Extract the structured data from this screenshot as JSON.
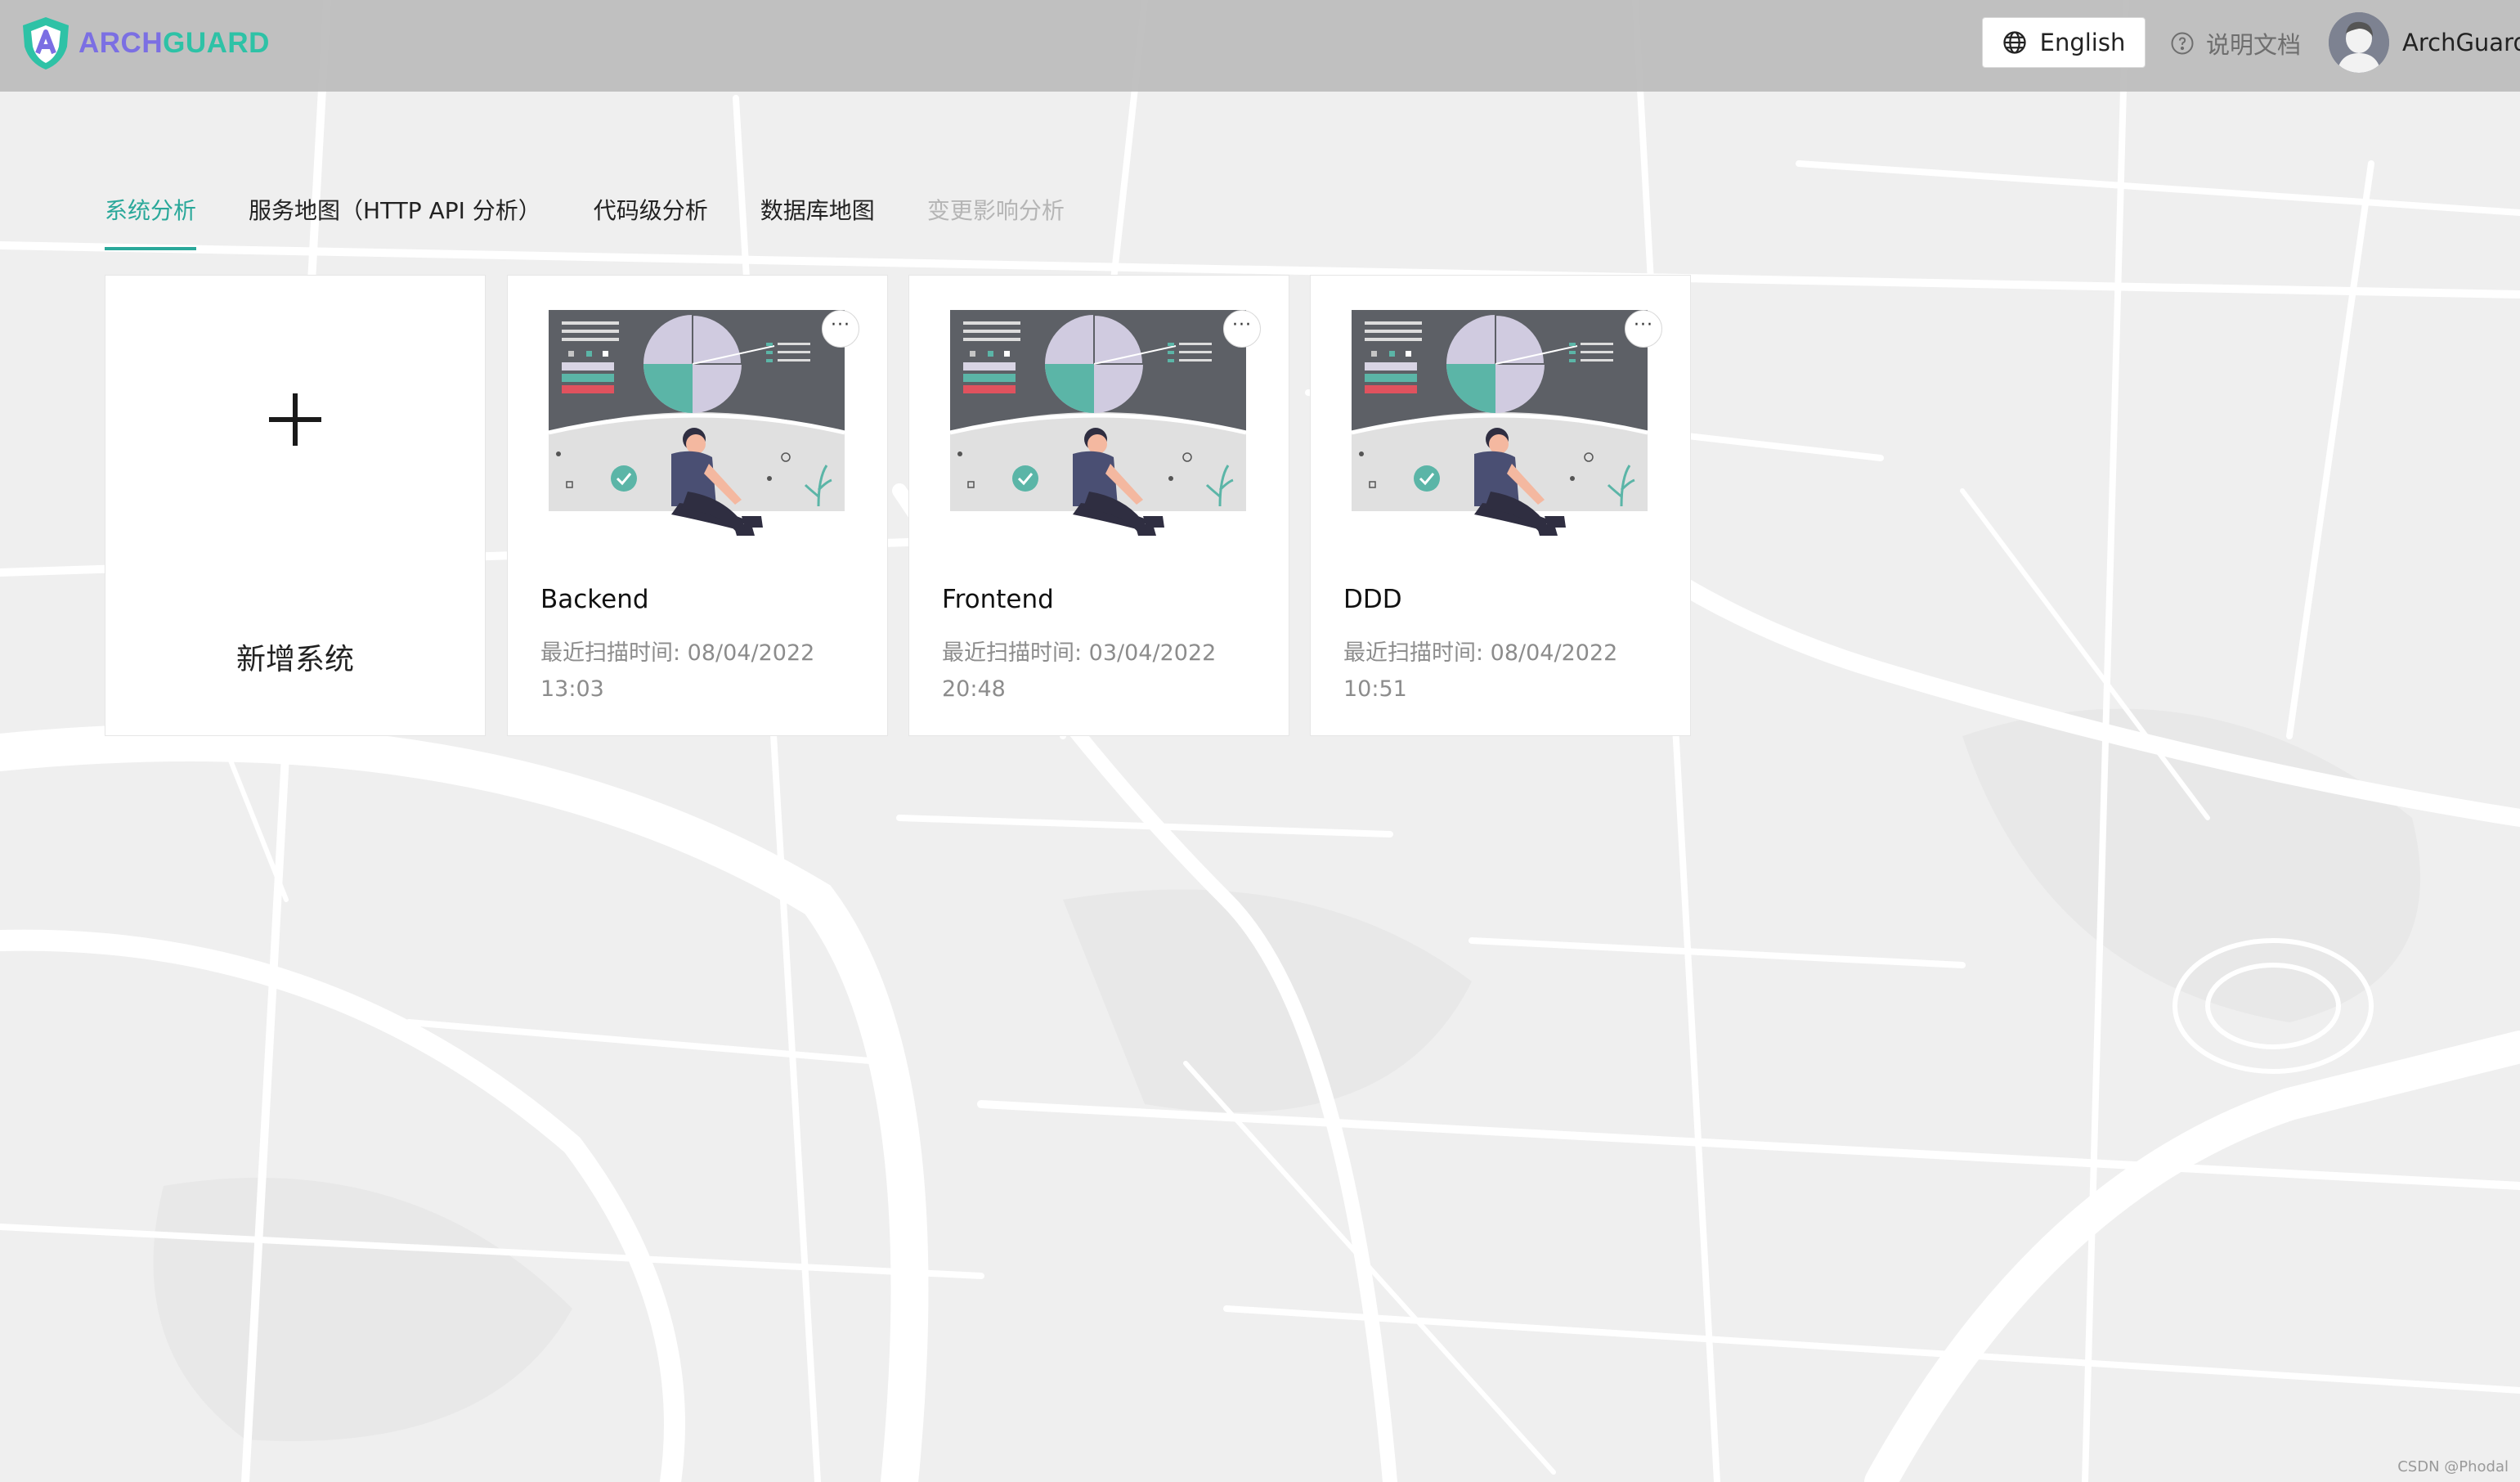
{
  "brand": {
    "part1": "ARCH",
    "part2": "GUARD"
  },
  "header": {
    "language_label": "English",
    "docs_label": "说明文档",
    "user_name": "ArchGuard"
  },
  "tabs": [
    {
      "label": "系统分析"
    },
    {
      "label": "服务地图（HTTP API 分析）"
    },
    {
      "label": "代码级分析"
    },
    {
      "label": "数据库地图"
    },
    {
      "label": "变更影响分析"
    }
  ],
  "add_card": {
    "label": "新增系统"
  },
  "systems": [
    {
      "name": "Backend",
      "scan_label": "最近扫描时间: 08/04/2022 13:03"
    },
    {
      "name": "Frontend",
      "scan_label": "最近扫描时间: 03/04/2022 20:48"
    },
    {
      "name": "DDD",
      "scan_label": "最近扫描时间: 08/04/2022 10:51"
    }
  ],
  "more_button_label": "···",
  "watermark": "CSDN @Phodal",
  "colors": {
    "accent": "#2aa89a",
    "brand_purple": "#7b6fe3",
    "brand_green": "#2ec2a6",
    "header_bg": "#bcbcbc",
    "disabled_tab": "#b5b5b5"
  }
}
